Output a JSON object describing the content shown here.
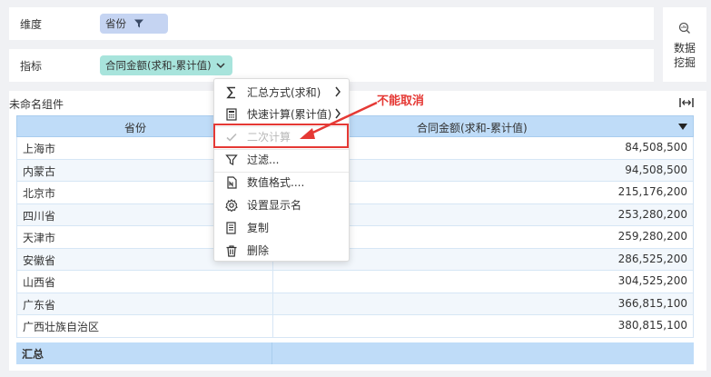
{
  "filters": {
    "dimension": {
      "label": "维度",
      "chip": "省份"
    },
    "indicator": {
      "label": "指标",
      "chip": "合同金额(求和-累计值)"
    }
  },
  "mining": {
    "label": "数据挖掘"
  },
  "widget": {
    "title": "未命名组件",
    "columns": [
      "省份",
      "合同金额(求和-累计值)"
    ],
    "rows": [
      {
        "province": "上海市",
        "amount": "84,508,500"
      },
      {
        "province": "内蒙古",
        "amount": "94,508,500"
      },
      {
        "province": "北京市",
        "amount": "215,176,200"
      },
      {
        "province": "四川省",
        "amount": "253,280,200"
      },
      {
        "province": "天津市",
        "amount": "259,280,200"
      },
      {
        "province": "安徽省",
        "amount": "286,525,200"
      },
      {
        "province": "山西省",
        "amount": "304,525,200"
      },
      {
        "province": "广东省",
        "amount": "366,815,100"
      },
      {
        "province": "广西壮族自治区",
        "amount": "380,815,100"
      }
    ],
    "total_label": "汇总"
  },
  "menu": {
    "items": [
      {
        "label": "汇总方式(求和)",
        "icon": "sigma-icon",
        "submenu": true,
        "disabled": false
      },
      {
        "label": "快速计算(累计值)",
        "icon": "calculator-icon",
        "submenu": true,
        "disabled": false
      },
      {
        "label": "二次计算",
        "icon": "check-icon",
        "submenu": false,
        "disabled": true
      },
      {
        "label": "过滤...",
        "icon": "filter-icon",
        "submenu": false,
        "disabled": false
      },
      {
        "label": "数值格式....",
        "icon": "number-format-icon",
        "submenu": false,
        "disabled": false
      },
      {
        "label": "设置显示名",
        "icon": "gear-icon",
        "submenu": false,
        "disabled": false
      },
      {
        "label": "复制",
        "icon": "copy-icon",
        "submenu": false,
        "disabled": false
      },
      {
        "label": "删除",
        "icon": "trash-icon",
        "submenu": false,
        "disabled": false
      }
    ]
  },
  "annotation": {
    "text": "不能取消",
    "color": "#e53935"
  },
  "colors": {
    "header_bg": "#bfdcf8",
    "dim_chip": "#c5d4f2",
    "ind_chip": "#a8e4dc",
    "highlight": "#e53935"
  }
}
